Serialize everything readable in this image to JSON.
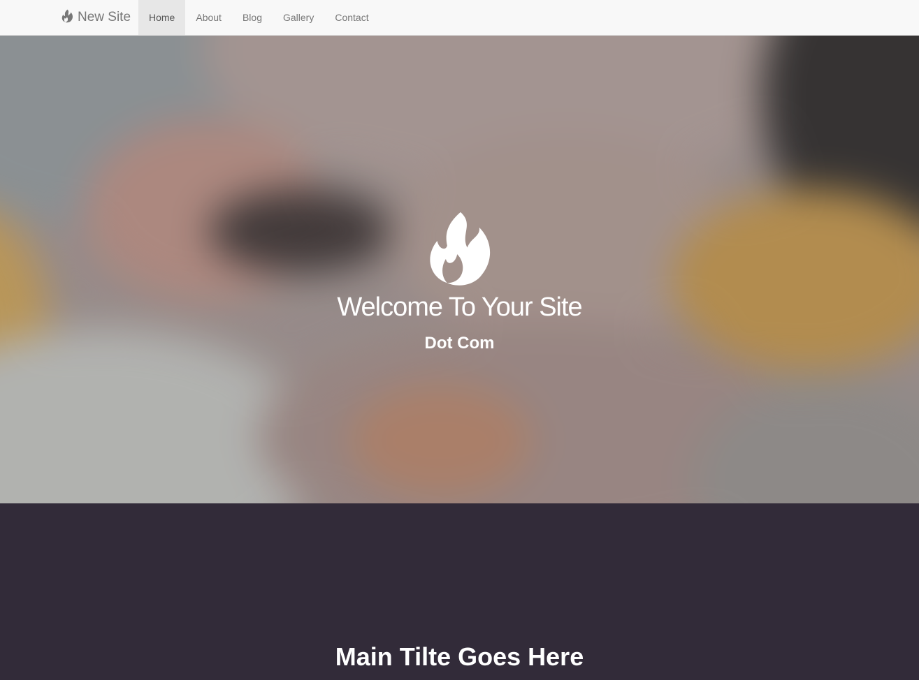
{
  "navbar": {
    "brand": {
      "label": "New Site",
      "icon": "flame-icon"
    },
    "items": [
      {
        "label": "Home",
        "active": true
      },
      {
        "label": "About",
        "active": false
      },
      {
        "label": "Blog",
        "active": false
      },
      {
        "label": "Gallery",
        "active": false
      },
      {
        "label": "Contact",
        "active": false
      }
    ]
  },
  "hero": {
    "logo_icon": "flame-icon",
    "title": "Welcome To Your Site",
    "subtitle": "Dot Com"
  },
  "main": {
    "title": "Main Tilte Goes Here"
  },
  "colors": {
    "navbar_bg": "#f8f8f8",
    "nav_active_bg": "#e7e7e7",
    "nav_text": "#777777",
    "section_bg": "#322b39",
    "hero_text": "#ffffff"
  }
}
